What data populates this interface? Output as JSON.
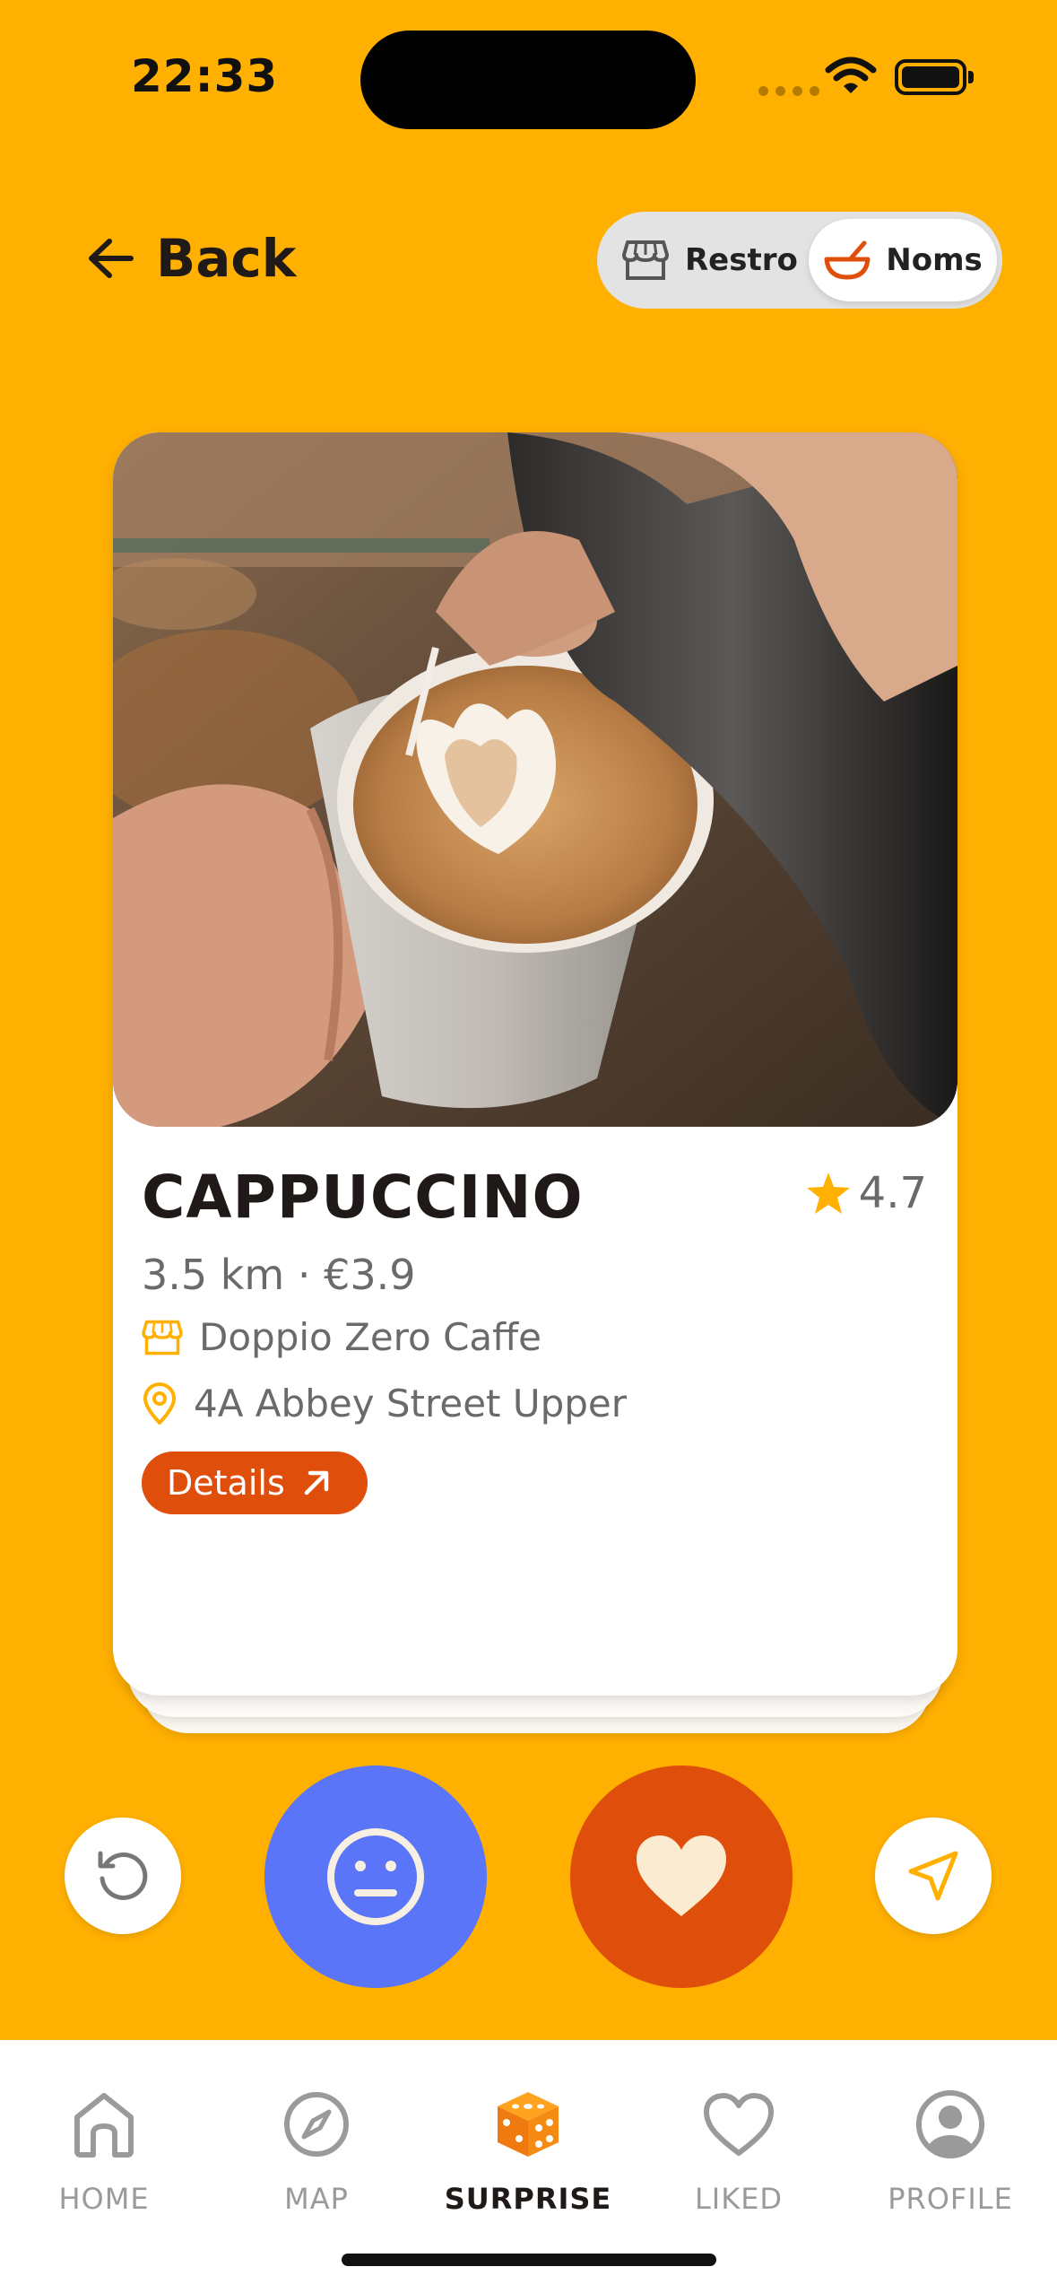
{
  "status_bar": {
    "time": "22:33"
  },
  "header": {
    "back_label": "Back",
    "toggle": [
      {
        "label": "Restro",
        "icon": "store-icon",
        "selected": false
      },
      {
        "label": "Noms",
        "icon": "bowl-icon",
        "selected": true
      }
    ]
  },
  "card": {
    "photo": "latte-art-photo",
    "title": "CAPPUCCINO",
    "rating": "4.7",
    "meta": "3.5 km · €3.9",
    "venue": "Doppio Zero Caffe",
    "address": "4A Abbey Street Upper",
    "details_label": "Details"
  },
  "actions": [
    "undo-icon",
    "meh-face-icon",
    "heart-icon",
    "navigation-arrow-icon"
  ],
  "tabs": [
    {
      "label": "HOME",
      "icon": "home-icon"
    },
    {
      "label": "MAP",
      "icon": "compass-icon"
    },
    {
      "label": "SURPRISE",
      "icon": "dice-icon",
      "active": true
    },
    {
      "label": "LIKED",
      "icon": "heart-outline-icon"
    },
    {
      "label": "PROFILE",
      "icon": "profile-icon"
    }
  ],
  "colors": {
    "background": "#FFB000",
    "accent_orange": "#E04E0C",
    "meh_blue": "#5A75F7",
    "star": "#FFB000"
  }
}
